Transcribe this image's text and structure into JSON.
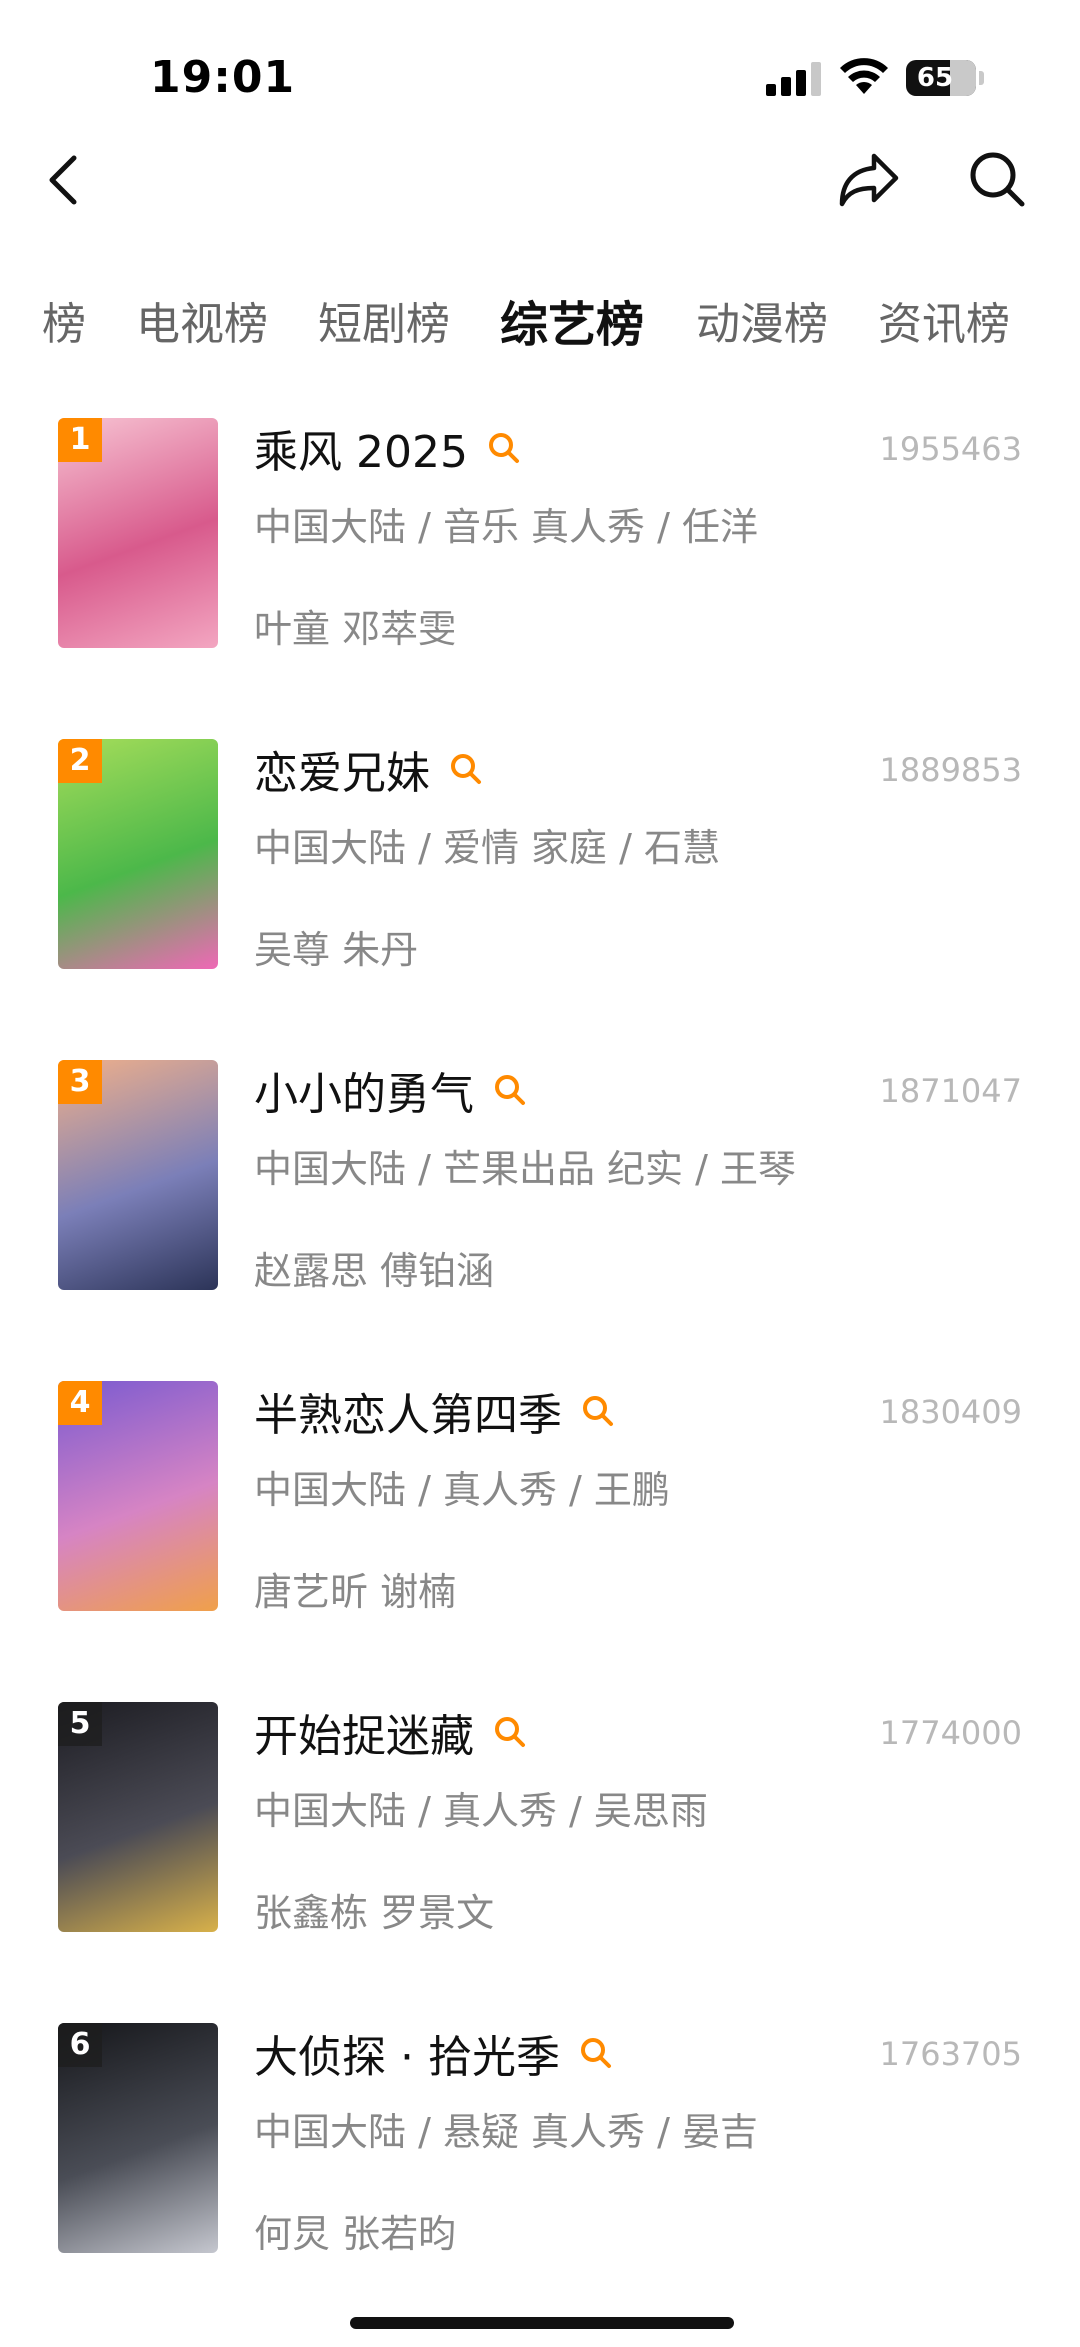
{
  "status_bar": {
    "time": "19:01",
    "battery": "65"
  },
  "tabs": [
    {
      "label": "榜"
    },
    {
      "label": "电视榜"
    },
    {
      "label": "短剧榜"
    },
    {
      "label": "综艺榜",
      "active": true
    },
    {
      "label": "动漫榜"
    },
    {
      "label": "资讯榜"
    }
  ],
  "items": [
    {
      "rank": "1",
      "title": "乘风 2025",
      "score": "1955463",
      "meta": "中国大陆 / 音乐 真人秀 / 任洋",
      "cast": "叶童 邓萃雯",
      "poster_colors": [
        "#f7c4d3",
        "#d85a8c",
        "#f3a6c1"
      ]
    },
    {
      "rank": "2",
      "title": "恋爱兄妹",
      "score": "1889853",
      "meta": "中国大陆 / 爱情 家庭 / 石慧",
      "cast": "吴尊 朱丹",
      "poster_colors": [
        "#a6dd5a",
        "#4cb84a",
        "#ef68b6"
      ]
    },
    {
      "rank": "3",
      "title": "小小的勇气",
      "score": "1871047",
      "meta": "中国大陆 / 芒果出品 纪实 / 王琴",
      "cast": "赵露思 傅铂涵",
      "poster_colors": [
        "#f0b08a",
        "#7b7fb8",
        "#2c3458"
      ]
    },
    {
      "rank": "4",
      "title": "半熟恋人第四季",
      "score": "1830409",
      "meta": "中国大陆 / 真人秀 / 王鹏",
      "cast": "唐艺昕 谢楠",
      "poster_colors": [
        "#7a5ad0",
        "#d684c4",
        "#f0a04a"
      ]
    },
    {
      "rank": "5",
      "title": "开始捉迷藏",
      "score": "1774000",
      "meta": "中国大陆 / 真人秀 / 吴思雨",
      "cast": "张鑫栋 罗景文",
      "poster_colors": [
        "#1c1c22",
        "#4b4b55",
        "#d8b14a"
      ]
    },
    {
      "rank": "6",
      "title": "大侦探 · 拾光季",
      "score": "1763705",
      "meta": "中国大陆 / 悬疑 真人秀 / 晏吉",
      "cast": "何炅 张若昀",
      "poster_colors": [
        "#15161a",
        "#4a4d56",
        "#c5c7cf"
      ]
    }
  ],
  "icons": {
    "back": "chevron-left-icon",
    "share": "share-arrow-icon",
    "search": "search-icon",
    "hot_search": "hot-search-icon"
  },
  "colors": {
    "accent": "#ff8a00",
    "text_primary": "#111111",
    "text_secondary": "#888888"
  }
}
